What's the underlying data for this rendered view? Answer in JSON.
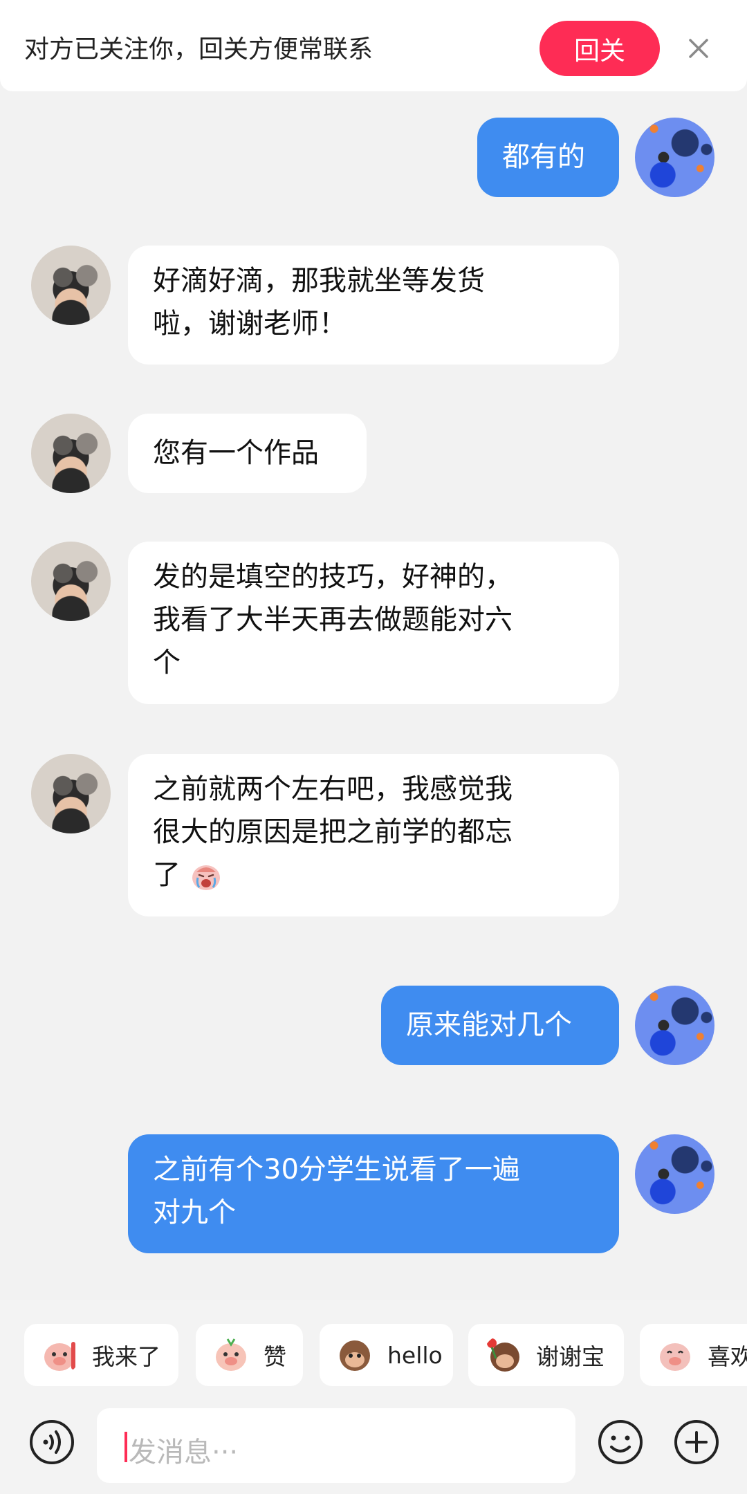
{
  "banner": {
    "text": "对方已关注你，回关方便常联系",
    "follow_back_label": "回关"
  },
  "messages": [
    {
      "direction": "out",
      "lines": [
        "都有的"
      ]
    },
    {
      "direction": "in",
      "lines": [
        "好滴好滴，那我就坐等发货",
        "啦，谢谢老师！"
      ]
    },
    {
      "direction": "in",
      "lines": [
        "您有一个作品"
      ]
    },
    {
      "direction": "in",
      "lines": [
        "发的是填空的技巧，好神的，",
        "我看了大半天再去做题能对六",
        "个"
      ]
    },
    {
      "direction": "in",
      "lines": [
        "之前就两个左右吧，我感觉我",
        "很大的原因是把之前学的都忘",
        "了"
      ],
      "trailing_emoji": "crying-face-emoji"
    },
    {
      "direction": "out",
      "lines": [
        "原来能对几个"
      ]
    },
    {
      "direction": "out",
      "lines": [
        "之前有个30分学生说看了一遍",
        "对九个"
      ]
    }
  ],
  "quick_stickers": [
    {
      "label": "我来了",
      "icon": "pig-waving-icon",
      "color": "#f5b8b0"
    },
    {
      "label": "赞",
      "icon": "pig-thumbs-up-icon",
      "color": "#f7c4b8"
    },
    {
      "label": "hello",
      "icon": "monkey-hello-icon",
      "color": "#8a5a3c"
    },
    {
      "label": "谢谢宝",
      "icon": "monkey-rose-icon",
      "color": "#7a4a30"
    },
    {
      "label": "喜欢",
      "icon": "pig-love-icon",
      "color": "#f3c0bb"
    }
  ],
  "composer": {
    "placeholder": "发消息···"
  },
  "colors": {
    "accent": "#fe2c55",
    "outgoing_bubble": "#3f8cf0",
    "incoming_bubble": "#ffffff",
    "background": "#f2f2f2"
  }
}
